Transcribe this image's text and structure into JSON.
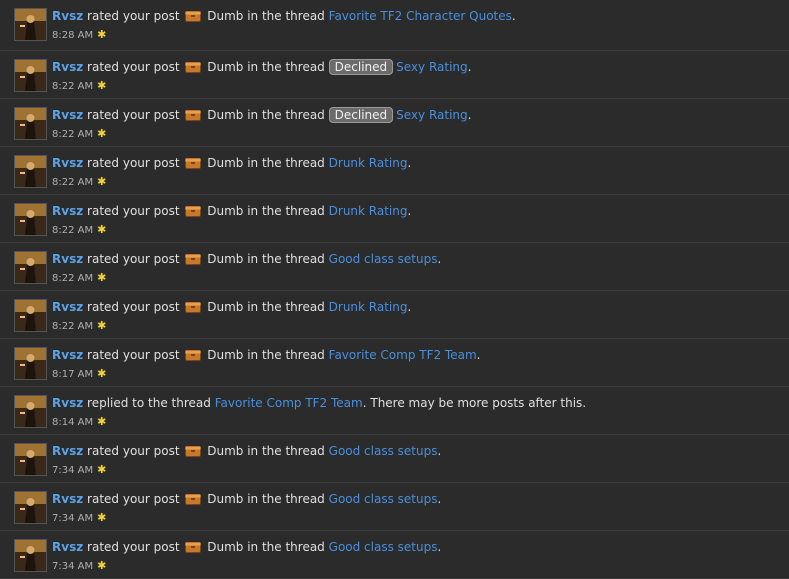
{
  "alerts": [
    {
      "user": "Rvsz",
      "action": "rated your post",
      "rating": "Dumb",
      "connector": "in the thread",
      "tag": "",
      "thread": "Favorite TF2 Character Quotes",
      "suffix": ".",
      "time": "8:28 AM",
      "star": "✱"
    },
    {
      "user": "Rvsz",
      "action": "rated your post",
      "rating": "Dumb",
      "connector": "in the thread",
      "tag": "Declined",
      "thread": "Sexy Rating",
      "suffix": ".",
      "time": "8:22 AM",
      "star": "✱"
    },
    {
      "user": "Rvsz",
      "action": "rated your post",
      "rating": "Dumb",
      "connector": "in the thread",
      "tag": "Declined",
      "thread": "Sexy Rating",
      "suffix": ".",
      "time": "8:22 AM",
      "star": "✱"
    },
    {
      "user": "Rvsz",
      "action": "rated your post",
      "rating": "Dumb",
      "connector": "in the thread",
      "tag": "",
      "thread": "Drunk Rating",
      "suffix": ".",
      "time": "8:22 AM",
      "star": "✱"
    },
    {
      "user": "Rvsz",
      "action": "rated your post",
      "rating": "Dumb",
      "connector": "in the thread",
      "tag": "",
      "thread": "Drunk Rating",
      "suffix": ".",
      "time": "8:22 AM",
      "star": "✱"
    },
    {
      "user": "Rvsz",
      "action": "rated your post",
      "rating": "Dumb",
      "connector": "in the thread",
      "tag": "",
      "thread": "Good class setups",
      "suffix": ".",
      "time": "8:22 AM",
      "star": "✱"
    },
    {
      "user": "Rvsz",
      "action": "rated your post",
      "rating": "Dumb",
      "connector": "in the thread",
      "tag": "",
      "thread": "Drunk Rating",
      "suffix": ".",
      "time": "8:22 AM",
      "star": "✱"
    },
    {
      "user": "Rvsz",
      "action": "rated your post",
      "rating": "Dumb",
      "connector": "in the thread",
      "tag": "",
      "thread": "Favorite Comp TF2 Team",
      "suffix": ".",
      "time": "8:17 AM",
      "star": "✱"
    },
    {
      "user": "Rvsz",
      "action": "replied to the thread",
      "rating": "",
      "connector": "",
      "tag": "",
      "thread": "Favorite Comp TF2 Team",
      "suffix": ". There may be more posts after this.",
      "time": "8:14 AM",
      "star": "✱"
    },
    {
      "user": "Rvsz",
      "action": "rated your post",
      "rating": "Dumb",
      "connector": "in the thread",
      "tag": "",
      "thread": "Good class setups",
      "suffix": ".",
      "time": "7:34 AM",
      "star": "✱"
    },
    {
      "user": "Rvsz",
      "action": "rated your post",
      "rating": "Dumb",
      "connector": "in the thread",
      "tag": "",
      "thread": "Good class setups",
      "suffix": ".",
      "time": "7:34 AM",
      "star": "✱"
    },
    {
      "user": "Rvsz",
      "action": "rated your post",
      "rating": "Dumb",
      "connector": "in the thread",
      "tag": "",
      "thread": "Good class setups",
      "suffix": ".",
      "time": "7:34 AM",
      "star": "✱"
    }
  ],
  "colors": {
    "username": "#5ca1e6",
    "link": "#4a8fdc",
    "star": "#f3d23a",
    "background": "#2b2b2b"
  },
  "icons": {
    "rating": "dumb-rating-icon",
    "avatar": "user-avatar"
  }
}
